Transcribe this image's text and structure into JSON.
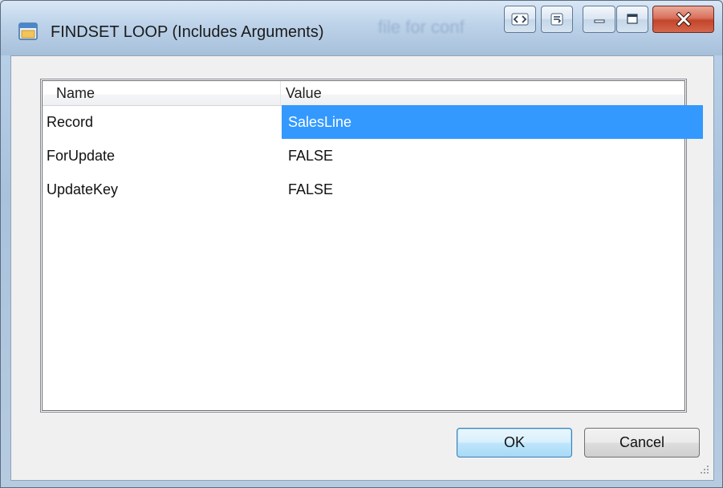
{
  "window": {
    "title": "FINDSET LOOP (Includes Arguments)",
    "background_title_fragment": "file for conf"
  },
  "caption_buttons": [
    "code-toggle-icon",
    "restore-icon",
    "minimize-icon",
    "maximize-icon",
    "close-icon"
  ],
  "list": {
    "columns": {
      "name": "Name",
      "value": "Value"
    },
    "rows": [
      {
        "name": "Record",
        "value": "SalesLine",
        "selected": true
      },
      {
        "name": "ForUpdate",
        "value": "FALSE",
        "selected": false
      },
      {
        "name": "UpdateKey",
        "value": "FALSE",
        "selected": false
      }
    ]
  },
  "buttons": {
    "ok": "OK",
    "cancel": "Cancel"
  },
  "colors": {
    "selection": "#3399ff",
    "close_button": "#c2452a"
  }
}
